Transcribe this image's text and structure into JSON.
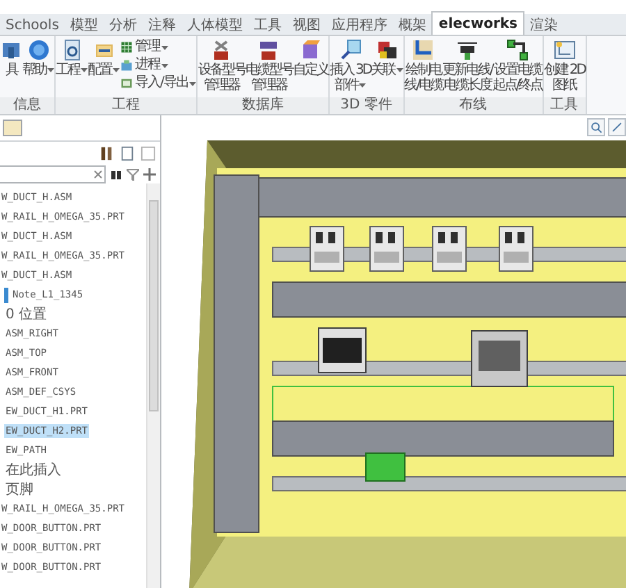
{
  "tabs": [
    {
      "label": "Schools",
      "selected": false
    },
    {
      "label": "模型",
      "selected": false
    },
    {
      "label": "分析",
      "selected": false
    },
    {
      "label": "注释",
      "selected": false
    },
    {
      "label": "人体模型",
      "selected": false
    },
    {
      "label": "工具",
      "selected": false
    },
    {
      "label": "视图",
      "selected": false
    },
    {
      "label": "应用程序",
      "selected": false
    },
    {
      "label": "概架",
      "selected": false
    },
    {
      "label": "elecworks",
      "selected": true
    },
    {
      "label": "渲染",
      "selected": false
    }
  ],
  "ribbon": [
    {
      "label": "信息",
      "items": [
        {
          "kind": "large",
          "lines": [
            "具"
          ],
          "dropdown": false
        },
        {
          "kind": "large",
          "lines": [
            "帮助"
          ],
          "dropdown": true
        }
      ]
    },
    {
      "label": "工程",
      "items": [
        {
          "kind": "large",
          "lines": [
            "工程"
          ],
          "dropdown": true
        },
        {
          "kind": "large",
          "lines": [
            "配置"
          ],
          "dropdown": true
        },
        {
          "kind": "stack",
          "entries": [
            {
              "label": "管理",
              "dropdown": true
            },
            {
              "label": "进程",
              "dropdown": true
            },
            {
              "label": "导入/导出",
              "dropdown": true
            }
          ]
        }
      ]
    },
    {
      "label": "数据库",
      "items": [
        {
          "kind": "large",
          "lines": [
            "设备型号",
            "管理器"
          ],
          "dropdown": false
        },
        {
          "kind": "large",
          "lines": [
            "电缆型号",
            "管理器"
          ],
          "dropdown": false
        },
        {
          "kind": "large",
          "lines": [
            "自定义"
          ],
          "dropdown": false
        }
      ]
    },
    {
      "label": "3D 零件",
      "items": [
        {
          "kind": "large",
          "lines": [
            "插入 3D",
            "部件"
          ],
          "dropdown": true
        },
        {
          "kind": "large",
          "lines": [
            "关联"
          ],
          "dropdown": true
        }
      ]
    },
    {
      "label": "布线",
      "items": [
        {
          "kind": "large",
          "lines": [
            "绘制电",
            "线/电缆"
          ],
          "dropdown": false
        },
        {
          "kind": "large",
          "lines": [
            "更新电线/",
            "电缆长度"
          ],
          "dropdown": false
        },
        {
          "kind": "large",
          "lines": [
            "设置电缆",
            "起点/终点"
          ],
          "dropdown": false
        }
      ]
    },
    {
      "label": "工具",
      "items": [
        {
          "kind": "large",
          "lines": [
            "创建 2D",
            "图纸"
          ],
          "dropdown": false
        }
      ]
    }
  ],
  "tree": [
    {
      "label": "W_DUCT_H.ASM",
      "selected": false
    },
    {
      "label": "W_RAIL_H_OMEGA_35.PRT",
      "selected": false
    },
    {
      "label": "W_DUCT_H.ASM",
      "selected": false
    },
    {
      "label": "W_RAIL_H_OMEGA_35.PRT",
      "selected": false
    },
    {
      "label": "W_DUCT_H.ASM",
      "selected": false,
      "children": [
        {
          "label": "Note_L1_1345",
          "selected": false,
          "kind": "note"
        },
        {
          "label": "0 位置",
          "selected": false
        },
        {
          "label": "ASM_RIGHT",
          "selected": false
        },
        {
          "label": "ASM_TOP",
          "selected": false
        },
        {
          "label": "ASM_FRONT",
          "selected": false
        },
        {
          "label": "ASM_DEF_CSYS",
          "selected": false
        },
        {
          "label": "EW_DUCT_H1.PRT",
          "selected": false
        },
        {
          "label": "EW_DUCT_H2.PRT",
          "selected": true
        },
        {
          "label": "EW_PATH",
          "selected": false
        },
        {
          "label": "在此插入",
          "selected": false
        },
        {
          "label": "页脚",
          "selected": false
        }
      ]
    },
    {
      "label": "W_RAIL_H_OMEGA_35.PRT",
      "selected": false
    },
    {
      "label": "W_DOOR_BUTTON.PRT",
      "selected": false
    },
    {
      "label": "W_DOOR_BUTTON.PRT",
      "selected": false
    },
    {
      "label": "W_DOOR_BUTTON.PRT",
      "selected": false
    }
  ]
}
